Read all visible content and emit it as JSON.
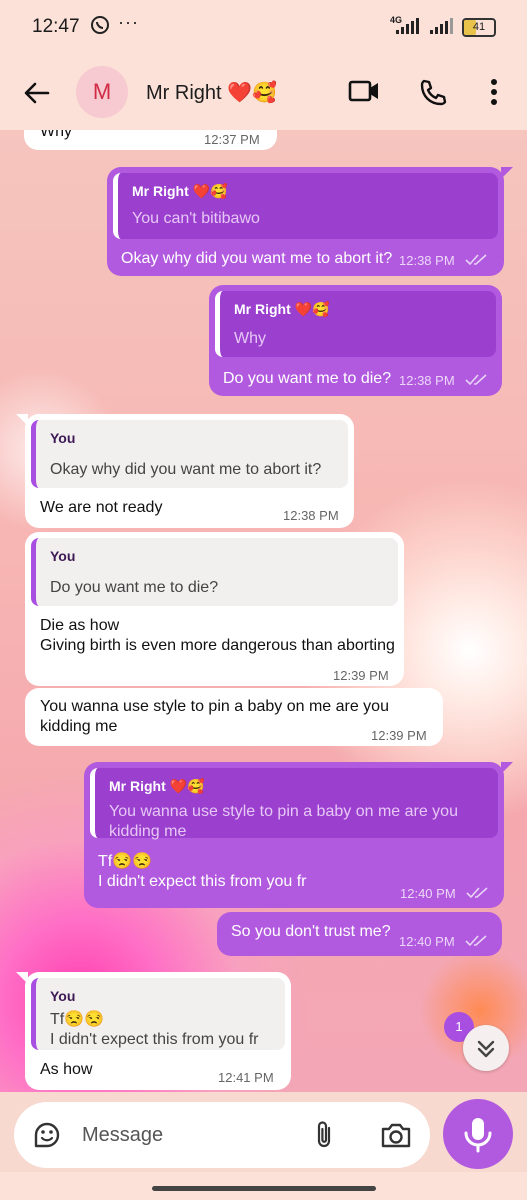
{
  "status_bar": {
    "time": "12:47",
    "app_icon": "whatsapp-icon",
    "more": "···",
    "network": "4G",
    "battery": "41"
  },
  "header": {
    "avatar_letter": "M",
    "title": "Mr Right ❤️🥰"
  },
  "messages": [
    {
      "dir": "in",
      "body": "Why",
      "time": "12:37 PM"
    },
    {
      "dir": "out",
      "quote_name": "Mr Right ❤️🥰",
      "quote_text": "You can't  bitibawo",
      "body": "Okay why did you want me to abort it?",
      "time": "12:38 PM"
    },
    {
      "dir": "out",
      "quote_name": "Mr Right ❤️🥰",
      "quote_text": "Why",
      "body": "Do you want me to die?",
      "time": "12:38 PM"
    },
    {
      "dir": "in",
      "quote_name": "You",
      "quote_text": "Okay why did you want me to abort it?",
      "body": "We are not ready",
      "time": "12:38 PM"
    },
    {
      "dir": "in",
      "quote_name": "You",
      "quote_text": "Do you want me to die?",
      "body_lines": [
        "Die as how",
        "Giving birth is even more dangerous than aborting"
      ],
      "time": "12:39 PM"
    },
    {
      "dir": "in",
      "body_lines": [
        "You wanna use style to pin a baby on me are you",
        "kidding me"
      ],
      "time": "12:39 PM"
    },
    {
      "dir": "out",
      "quote_name": "Mr Right ❤️🥰",
      "quote_lines": [
        "You wanna use style to pin a baby on me are you",
        "kidding me"
      ],
      "body_lines": [
        "Tf😒😒",
        "I didn't expect this from you fr"
      ],
      "time": "12:40 PM"
    },
    {
      "dir": "out",
      "body": "So you don't trust me?",
      "time": "12:40 PM"
    },
    {
      "dir": "in",
      "quote_name": "You",
      "quote_lines": [
        "Tf😒😒",
        "I didn't expect this from you fr"
      ],
      "body": "As how",
      "time": "12:41 PM"
    }
  ],
  "unread_badge": "1",
  "composer": {
    "placeholder": "Message"
  },
  "colors": {
    "accent": "#b25adf",
    "header_bg": "#fbe1d8"
  }
}
